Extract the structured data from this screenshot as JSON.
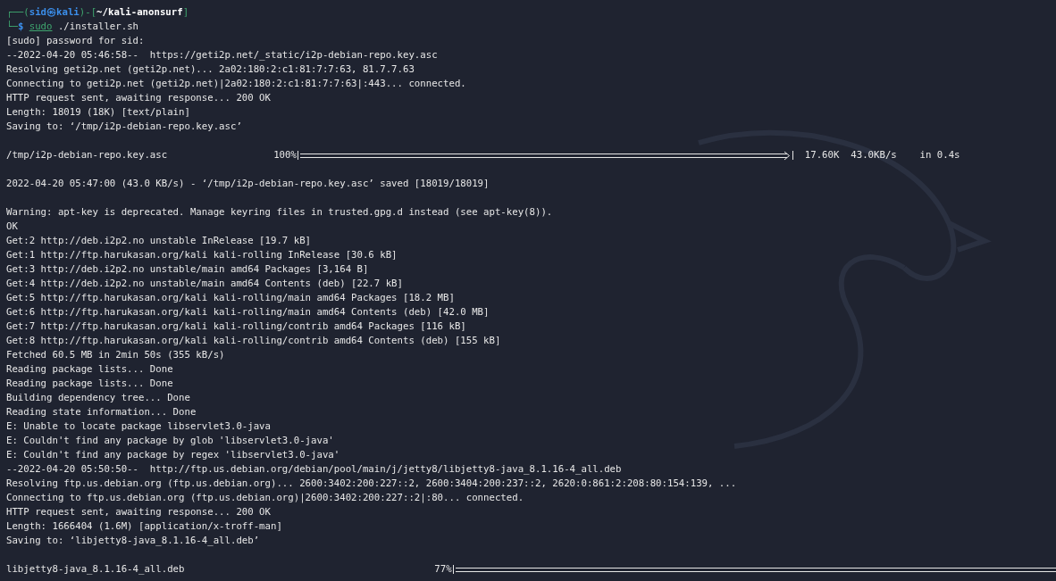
{
  "terminal": {
    "prompt": [
      [
        {
          "kind": "frame",
          "text": "┌──("
        },
        {
          "kind": "user",
          "text": "sid㉿kali"
        },
        {
          "kind": "frame",
          "text": ")-["
        },
        {
          "kind": "path",
          "text": "~/kali-anonsurf"
        },
        {
          "kind": "frame",
          "text": "]"
        }
      ],
      [
        {
          "kind": "frame",
          "text": "└─"
        },
        {
          "kind": "sign",
          "text": "$"
        },
        {
          "kind": "command",
          "text": "sudo"
        },
        {
          "kind": "args",
          "text": " ./installer.sh"
        }
      ]
    ],
    "lines": [
      {
        "kind": "text",
        "text": "[sudo] password for sid:"
      },
      {
        "kind": "text",
        "text": "--2022-04-20 05:46:58--  https://geti2p.net/_static/i2p-debian-repo.key.asc"
      },
      {
        "kind": "text",
        "text": "Resolving geti2p.net (geti2p.net)... 2a02:180:2:c1:81:7:7:63, 81.7.7.63"
      },
      {
        "kind": "text",
        "text": "Connecting to geti2p.net (geti2p.net)|2a02:180:2:c1:81:7:7:63|:443... connected."
      },
      {
        "kind": "text",
        "text": "HTTP request sent, awaiting response... 200 OK"
      },
      {
        "kind": "text",
        "text": "Length: 18019 (18K) [text/plain]"
      },
      {
        "kind": "text",
        "text": "Saving to: ‘/tmp/i2p-debian-repo.key.asc’"
      },
      {
        "kind": "blank"
      },
      {
        "kind": "progress",
        "file": "/tmp/i2p-debian-repo.key.asc",
        "percent": "100%",
        "level": 1,
        "closed": true,
        "stats": "17.60K  43.0KB/s    in 0.4s"
      },
      {
        "kind": "blank"
      },
      {
        "kind": "text",
        "text": "2022-04-20 05:47:00 (43.0 KB/s) - ‘/tmp/i2p-debian-repo.key.asc’ saved [18019/18019]"
      },
      {
        "kind": "blank"
      },
      {
        "kind": "text",
        "text": "Warning: apt-key is deprecated. Manage keyring files in trusted.gpg.d instead (see apt-key(8))."
      },
      {
        "kind": "text",
        "text": "OK"
      },
      {
        "kind": "text",
        "text": "Get:2 http://deb.i2p2.no unstable InRelease [19.7 kB]"
      },
      {
        "kind": "text",
        "text": "Get:1 http://ftp.harukasan.org/kali kali-rolling InRelease [30.6 kB]"
      },
      {
        "kind": "text",
        "text": "Get:3 http://deb.i2p2.no unstable/main amd64 Packages [3,164 B]"
      },
      {
        "kind": "text",
        "text": "Get:4 http://deb.i2p2.no unstable/main amd64 Contents (deb) [22.7 kB]"
      },
      {
        "kind": "text",
        "text": "Get:5 http://ftp.harukasan.org/kali kali-rolling/main amd64 Packages [18.2 MB]"
      },
      {
        "kind": "text",
        "text": "Get:6 http://ftp.harukasan.org/kali kali-rolling/main amd64 Contents (deb) [42.0 MB]"
      },
      {
        "kind": "text",
        "text": "Get:7 http://ftp.harukasan.org/kali kali-rolling/contrib amd64 Packages [116 kB]"
      },
      {
        "kind": "text",
        "text": "Get:8 http://ftp.harukasan.org/kali kali-rolling/contrib amd64 Contents (deb) [155 kB]"
      },
      {
        "kind": "text",
        "text": "Fetched 60.5 MB in 2min 50s (355 kB/s)"
      },
      {
        "kind": "text",
        "text": "Reading package lists... Done"
      },
      {
        "kind": "text",
        "text": "Reading package lists... Done"
      },
      {
        "kind": "text",
        "text": "Building dependency tree... Done"
      },
      {
        "kind": "text",
        "text": "Reading state information... Done"
      },
      {
        "kind": "text",
        "text": "E: Unable to locate package libservlet3.0-java"
      },
      {
        "kind": "text",
        "text": "E: Couldn't find any package by glob 'libservlet3.0-java'"
      },
      {
        "kind": "text",
        "text": "E: Couldn't find any package by regex 'libservlet3.0-java'"
      },
      {
        "kind": "text",
        "text": "--2022-04-20 05:50:50--  http://ftp.us.debian.org/debian/pool/main/j/jetty8/libjetty8-java_8.1.16-4_all.deb"
      },
      {
        "kind": "text",
        "text": "Resolving ftp.us.debian.org (ftp.us.debian.org)... 2600:3402:200:227::2, 2600:3404:200:237::2, 2620:0:861:2:208:80:154:139, ..."
      },
      {
        "kind": "text",
        "text": "Connecting to ftp.us.debian.org (ftp.us.debian.org)|2600:3402:200:227::2|:80... connected."
      },
      {
        "kind": "text",
        "text": "HTTP request sent, awaiting response... 200 OK"
      },
      {
        "kind": "text",
        "text": "Length: 1666404 (1.6M) [application/x-troff-man]"
      },
      {
        "kind": "text",
        "text": "Saving to: ‘libjetty8-java_8.1.16-4_all.deb’"
      },
      {
        "kind": "blank"
      },
      {
        "kind": "progress",
        "file": "libjetty8-java_8.1.16-4_all.deb",
        "percent": "77%",
        "level": 1,
        "closed": false
      }
    ]
  }
}
